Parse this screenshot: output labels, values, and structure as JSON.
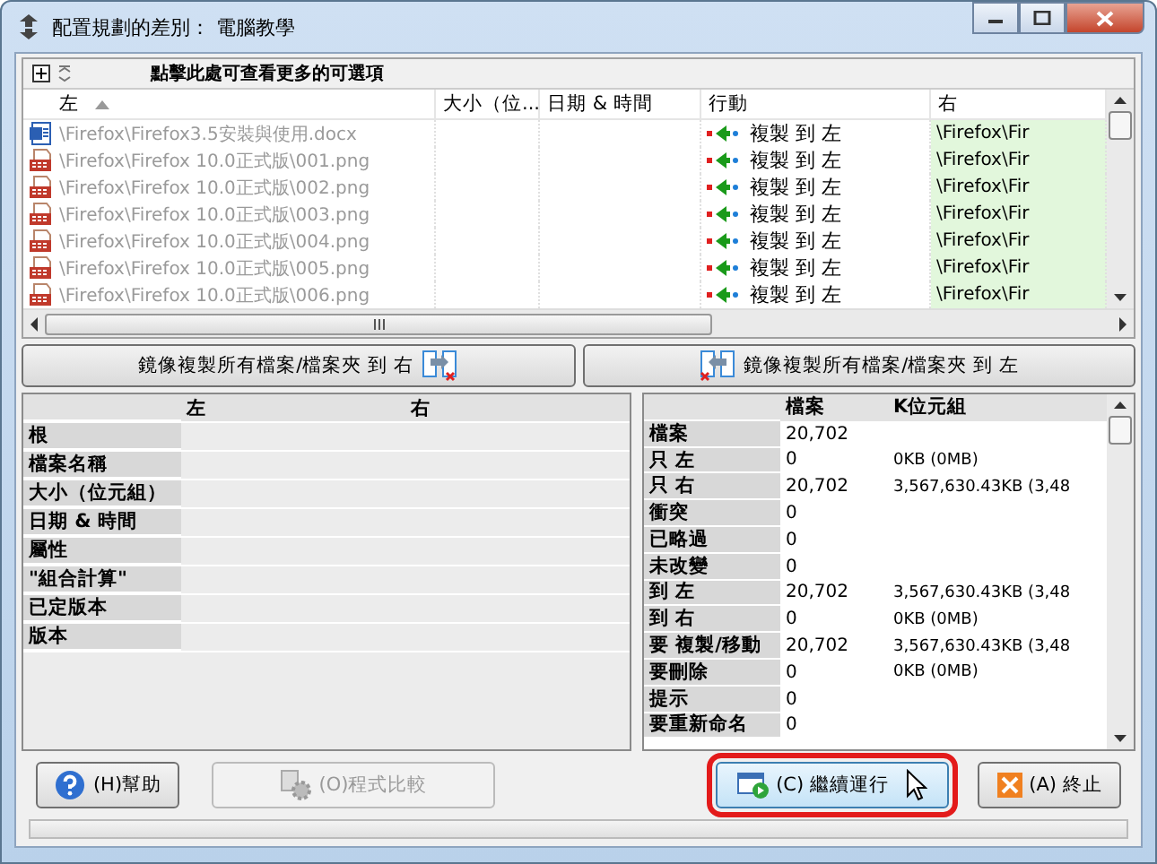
{
  "window": {
    "title": "配置規劃的差別： 電腦教學"
  },
  "toolbar": {
    "hint": "點擊此處可查看更多的可選項"
  },
  "file_list": {
    "columns": [
      {
        "label": "左",
        "sorted": true
      },
      {
        "label": "大小（位..."
      },
      {
        "label": "日期 & 時間"
      },
      {
        "label": "行動"
      },
      {
        "label": "右"
      }
    ],
    "rows": [
      {
        "kind": "docx",
        "left": "\\Firefox\\Firefox3.5安裝與使用.docx",
        "action": "複製 到 左",
        "right": "\\Firefox\\Fir"
      },
      {
        "kind": "png",
        "left": "\\Firefox\\Firefox 10.0正式版\\001.png",
        "action": "複製 到 左",
        "right": "\\Firefox\\Fir"
      },
      {
        "kind": "png",
        "left": "\\Firefox\\Firefox 10.0正式版\\002.png",
        "action": "複製 到 左",
        "right": "\\Firefox\\Fir"
      },
      {
        "kind": "png",
        "left": "\\Firefox\\Firefox 10.0正式版\\003.png",
        "action": "複製 到 左",
        "right": "\\Firefox\\Fir"
      },
      {
        "kind": "png",
        "left": "\\Firefox\\Firefox 10.0正式版\\004.png",
        "action": "複製 到 左",
        "right": "\\Firefox\\Fir"
      },
      {
        "kind": "png",
        "left": "\\Firefox\\Firefox 10.0正式版\\005.png",
        "action": "複製 到 左",
        "right": "\\Firefox\\Fir"
      },
      {
        "kind": "png",
        "left": "\\Firefox\\Firefox 10.0正式版\\006.png",
        "action": "複製 到 左",
        "right": "\\Firefox\\Fir"
      }
    ]
  },
  "mirror_buttons": [
    {
      "label": "鏡像複製所有檔案/檔案夾 到 右"
    },
    {
      "label": "鏡像複製所有檔案/檔案夾 到 左"
    }
  ],
  "details": {
    "columns": [
      "左",
      "右"
    ],
    "rows": [
      "根",
      "檔案名稱",
      "大小（位元組）",
      "日期 & 時間",
      "屬性",
      "\"組合計算\"",
      "已定版本",
      "版本"
    ]
  },
  "stats": {
    "columns": [
      "檔案",
      "K位元組"
    ],
    "rows": [
      {
        "label": "檔案",
        "files": "20,702"
      },
      {
        "label": "只 左",
        "files": "0",
        "size": "0KB (0MB)"
      },
      {
        "label": "只 右",
        "files": "20,702",
        "size": "3,567,630.43KB (3,48"
      },
      {
        "label": "衝突",
        "files": "0"
      },
      {
        "label": "已略過",
        "files": "0"
      },
      {
        "label": "未改變",
        "files": "0"
      },
      {
        "label": "到 左",
        "files": "20,702",
        "size": "3,567,630.43KB (3,48"
      },
      {
        "label": "到 右",
        "files": "0",
        "size": "0KB (0MB)"
      },
      {
        "label": "要 複製/移動",
        "files": "20,702",
        "size": "3,567,630.43KB (3,48"
      },
      {
        "label": "要刪除",
        "files": "0",
        "size": "0KB (0MB)"
      },
      {
        "label": "提示",
        "files": "0"
      },
      {
        "label": "要重新命名",
        "files": "0"
      }
    ]
  },
  "buttons": [
    {
      "kind": "help",
      "label": "(H)幫助",
      "disabled": false,
      "highlighted": false
    },
    {
      "kind": "compare",
      "label": "(O)程式比較",
      "disabled": true,
      "highlighted": false
    },
    {
      "kind": "continue",
      "label": "(C) 繼續運行",
      "disabled": false,
      "highlighted": true
    },
    {
      "kind": "abort",
      "label": "(A) 終止",
      "disabled": false,
      "highlighted": false
    }
  ]
}
